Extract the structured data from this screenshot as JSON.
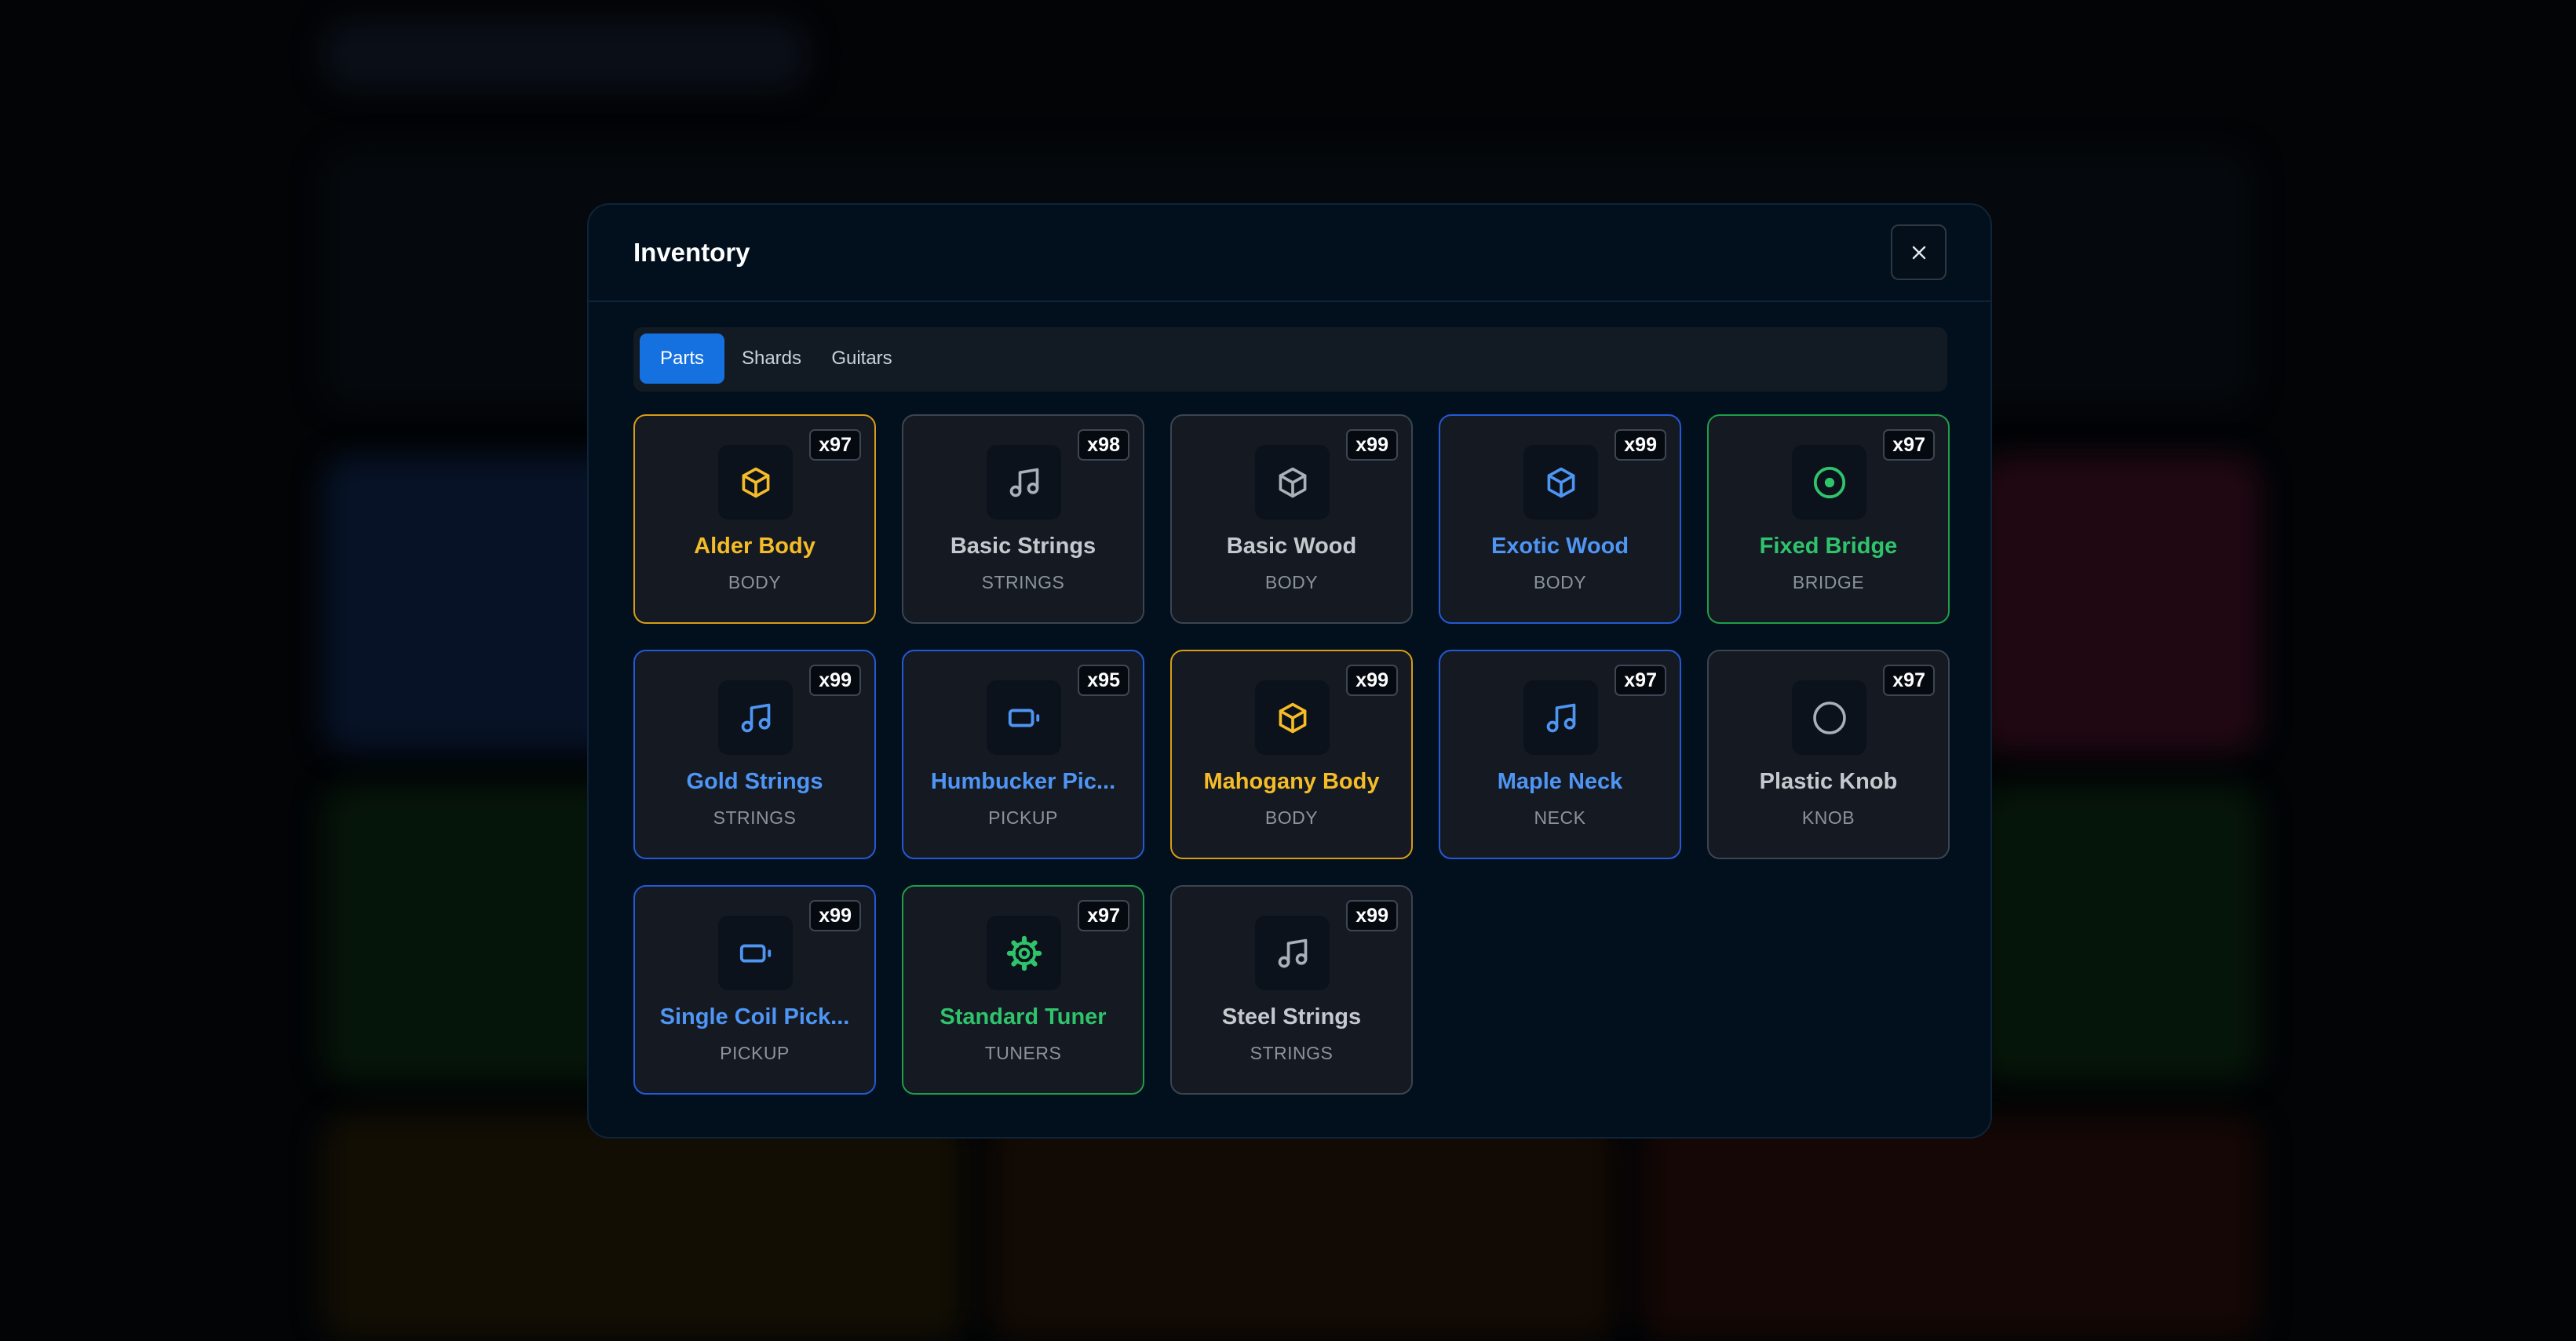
{
  "colors": {
    "yellow": "#f5bc27",
    "blue": "#4e95f4",
    "green": "#2fc36b",
    "gray": "#c5c9ce",
    "active_tab": "#1570e0"
  },
  "modal": {
    "title": "Inventory",
    "close_icon": "close-icon"
  },
  "tabs": [
    {
      "label": "Parts",
      "active": true
    },
    {
      "label": "Shards",
      "active": false
    },
    {
      "label": "Guitars",
      "active": false
    }
  ],
  "items": [
    {
      "name": "Alder Body",
      "category": "BODY",
      "count": "x97",
      "rarity": "yellow",
      "icon": "box-icon"
    },
    {
      "name": "Basic Strings",
      "category": "STRINGS",
      "count": "x98",
      "rarity": "gray",
      "icon": "music-note-icon"
    },
    {
      "name": "Basic Wood",
      "category": "BODY",
      "count": "x99",
      "rarity": "gray",
      "icon": "box-icon"
    },
    {
      "name": "Exotic Wood",
      "category": "BODY",
      "count": "x99",
      "rarity": "blue",
      "icon": "box-icon"
    },
    {
      "name": "Fixed Bridge",
      "category": "BRIDGE",
      "count": "x97",
      "rarity": "green",
      "icon": "target-icon"
    },
    {
      "name": "Gold Strings",
      "category": "STRINGS",
      "count": "x99",
      "rarity": "blue",
      "icon": "music-note-icon"
    },
    {
      "name": "Humbucker Pic...",
      "category": "PICKUP",
      "count": "x95",
      "rarity": "blue",
      "icon": "battery-icon"
    },
    {
      "name": "Mahogany Body",
      "category": "BODY",
      "count": "x99",
      "rarity": "yellow",
      "icon": "box-icon"
    },
    {
      "name": "Maple Neck",
      "category": "NECK",
      "count": "x97",
      "rarity": "blue",
      "icon": "music-note-icon"
    },
    {
      "name": "Plastic Knob",
      "category": "KNOB",
      "count": "x97",
      "rarity": "gray",
      "icon": "circle-icon"
    },
    {
      "name": "Single Coil Pick...",
      "category": "PICKUP",
      "count": "x99",
      "rarity": "blue",
      "icon": "battery-icon"
    },
    {
      "name": "Standard Tuner",
      "category": "TUNERS",
      "count": "x97",
      "rarity": "green",
      "icon": "gear-icon"
    },
    {
      "name": "Steel Strings",
      "category": "STRINGS",
      "count": "x99",
      "rarity": "gray",
      "icon": "music-note-icon"
    }
  ]
}
